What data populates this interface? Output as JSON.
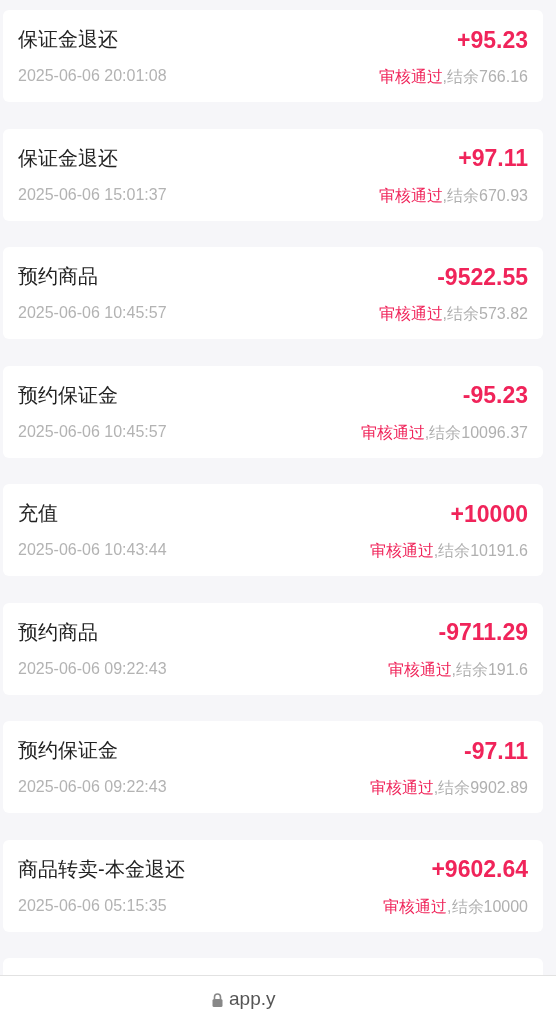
{
  "records": [
    {
      "title": "保证金退还",
      "time": "2025-06-06 20:01:08",
      "amount": "+95.23",
      "status": "审核通过",
      "balance": ",结余766.16"
    },
    {
      "title": "保证金退还",
      "time": "2025-06-06 15:01:37",
      "amount": "+97.11",
      "status": "审核通过",
      "balance": ",结余670.93"
    },
    {
      "title": "预约商品",
      "time": "2025-06-06 10:45:57",
      "amount": "-9522.55",
      "status": "审核通过",
      "balance": ",结余573.82"
    },
    {
      "title": "预约保证金",
      "time": "2025-06-06 10:45:57",
      "amount": "-95.23",
      "status": "审核通过",
      "balance": ",结余10096.37"
    },
    {
      "title": "充值",
      "time": "2025-06-06 10:43:44",
      "amount": "+10000",
      "status": "审核通过",
      "balance": ",结余10191.6"
    },
    {
      "title": "预约商品",
      "time": "2025-06-06 09:22:43",
      "amount": "-9711.29",
      "status": "审核通过",
      "balance": ",结余191.6"
    },
    {
      "title": "预约保证金",
      "time": "2025-06-06 09:22:43",
      "amount": "-97.11",
      "status": "审核通过",
      "balance": ",结余9902.89"
    },
    {
      "title": "商品转卖-本金退还",
      "time": "2025-06-06 05:15:35",
      "amount": "+9602.64",
      "status": "审核通过",
      "balance": ",结余10000"
    }
  ],
  "address_bar": {
    "url": "app.y"
  }
}
